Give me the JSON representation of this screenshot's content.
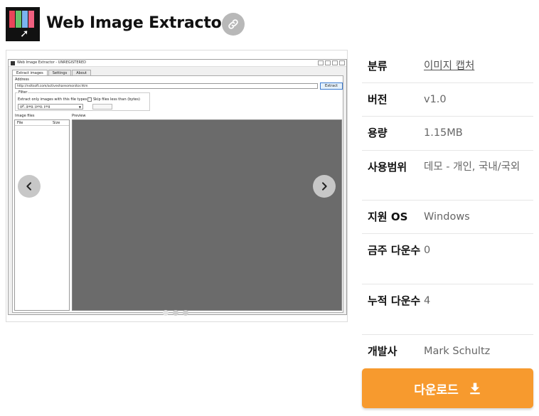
{
  "header": {
    "title": "Web Image Extractor",
    "logo_icon": "app-logo-icon",
    "share_icon": "link-icon"
  },
  "screenshot": {
    "window_title": "Web Image Extractor - UNREGISTERED",
    "tabs": [
      "Extract images",
      "Settings",
      "About"
    ],
    "address_label": "Address",
    "address_value": "http://nsltsoft.com/activeshareomonitor.htm",
    "extract_label": "Extract",
    "filter_label": "Filter",
    "filter_types_label": "Extract only images with this file types",
    "filter_types_value": "gif, jpeg, jpeg, png",
    "skip_label": "Skip files less than (bytes)",
    "image_files_label": "Image files",
    "preview_label": "Preview",
    "col_file": "File",
    "col_size": "Size"
  },
  "gallery": {
    "slide_count": 3,
    "active_index": 0,
    "prev_icon": "chevron-left-icon",
    "next_icon": "chevron-right-icon"
  },
  "info": {
    "rows": [
      {
        "key": "분류",
        "value": "이미지 캡처",
        "link": true
      },
      {
        "key": "버전",
        "value": "v1.0"
      },
      {
        "key": "용량",
        "value": "1.15MB"
      },
      {
        "key": "사용범위",
        "value": "데모 - 개인, 국내/국외"
      },
      {
        "key": "지원 OS",
        "value": "Windows"
      },
      {
        "key": "금주 다운수",
        "value": "0"
      },
      {
        "key": "누적 다운수",
        "value": "4"
      },
      {
        "key": "개발사",
        "value": "Mark Schultz"
      }
    ]
  },
  "download": {
    "label": "다운로드",
    "icon": "download-icon"
  },
  "colors": {
    "accent": "#f79a2e",
    "key_text": "#111111",
    "value_text": "#666666"
  }
}
